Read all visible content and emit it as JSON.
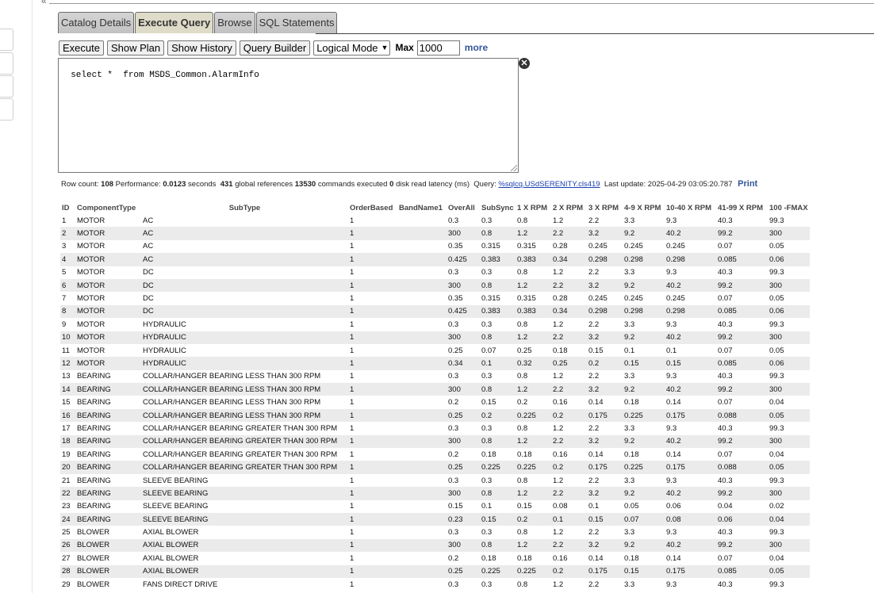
{
  "tabs": [
    {
      "label": "Catalog Details",
      "active": false
    },
    {
      "label": "Execute Query",
      "active": true
    },
    {
      "label": "Browse",
      "active": false
    },
    {
      "label": "SQL Statements",
      "active": false
    }
  ],
  "toolbar": {
    "execute": "Execute",
    "show_plan": "Show Plan",
    "show_history": "Show History",
    "query_builder": "Query Builder",
    "mode": "Logical Mode",
    "max_label": "Max",
    "max_value": "1000",
    "more": "more"
  },
  "query": {
    "text": "select *  from MSDS_Common.AlarmInfo",
    "clear_icon": "close-circle-icon"
  },
  "stats": {
    "row_count_label": "Row count:",
    "row_count": "108",
    "performance_label": "Performance:",
    "performance": "0.0123",
    "seconds": "seconds",
    "global_refs": "431",
    "global_refs_label": "global references",
    "commands": "13530",
    "commands_label": "commands executed",
    "disk_latency": "0",
    "disk_latency_label": "disk read latency (ms)",
    "query_label": "Query:",
    "query_link": "%sqlcq.USdSERENITY.cls419",
    "last_update_label": "Last update:",
    "last_update": "2025-04-29 03:05:20.787",
    "print": "Print"
  },
  "table": {
    "columns": [
      "ID",
      "ComponentType",
      "SubType",
      "OrderBased",
      "BandName1",
      "OverAll",
      "SubSync",
      "1 X RPM",
      "2 X RPM",
      "3 X RPM",
      "4-9 X RPM",
      "10-40 X RPM",
      "41-99 X RPM",
      "100 -FMAX"
    ],
    "rows": [
      [
        "1",
        "MOTOR",
        "AC",
        "1",
        "",
        "0.3",
        "0.3",
        "0.8",
        "1.2",
        "2.2",
        "3.3",
        "9.3",
        "40.3",
        "99.3"
      ],
      [
        "2",
        "MOTOR",
        "AC",
        "1",
        "",
        "300",
        "0.8",
        "1.2",
        "2.2",
        "3.2",
        "9.2",
        "40.2",
        "99.2",
        "300"
      ],
      [
        "3",
        "MOTOR",
        "AC",
        "1",
        "",
        "0.35",
        "0.315",
        "0.315",
        "0.28",
        "0.245",
        "0.245",
        "0.245",
        "0.07",
        "0.05"
      ],
      [
        "4",
        "MOTOR",
        "AC",
        "1",
        "",
        "0.425",
        "0.383",
        "0.383",
        "0.34",
        "0.298",
        "0.298",
        "0.298",
        "0.085",
        "0.06"
      ],
      [
        "5",
        "MOTOR",
        "DC",
        "1",
        "",
        "0.3",
        "0.3",
        "0.8",
        "1.2",
        "2.2",
        "3.3",
        "9.3",
        "40.3",
        "99.3"
      ],
      [
        "6",
        "MOTOR",
        "DC",
        "1",
        "",
        "300",
        "0.8",
        "1.2",
        "2.2",
        "3.2",
        "9.2",
        "40.2",
        "99.2",
        "300"
      ],
      [
        "7",
        "MOTOR",
        "DC",
        "1",
        "",
        "0.35",
        "0.315",
        "0.315",
        "0.28",
        "0.245",
        "0.245",
        "0.245",
        "0.07",
        "0.05"
      ],
      [
        "8",
        "MOTOR",
        "DC",
        "1",
        "",
        "0.425",
        "0.383",
        "0.383",
        "0.34",
        "0.298",
        "0.298",
        "0.298",
        "0.085",
        "0.06"
      ],
      [
        "9",
        "MOTOR",
        "HYDRAULIC",
        "1",
        "",
        "0.3",
        "0.3",
        "0.8",
        "1.2",
        "2.2",
        "3.3",
        "9.3",
        "40.3",
        "99.3"
      ],
      [
        "10",
        "MOTOR",
        "HYDRAULIC",
        "1",
        "",
        "300",
        "0.8",
        "1.2",
        "2.2",
        "3.2",
        "9.2",
        "40.2",
        "99.2",
        "300"
      ],
      [
        "11",
        "MOTOR",
        "HYDRAULIC",
        "1",
        "",
        "0.25",
        "0.07",
        "0.25",
        "0.18",
        "0.15",
        "0.1",
        "0.1",
        "0.07",
        "0.05"
      ],
      [
        "12",
        "MOTOR",
        "HYDRAULIC",
        "1",
        "",
        "0.34",
        "0.1",
        "0.32",
        "0.25",
        "0.2",
        "0.15",
        "0.15",
        "0.085",
        "0.06"
      ],
      [
        "13",
        "BEARING",
        "COLLAR/HANGER BEARING LESS THAN 300 RPM",
        "1",
        "",
        "0.3",
        "0.3",
        "0.8",
        "1.2",
        "2.2",
        "3.3",
        "9.3",
        "40.3",
        "99.3"
      ],
      [
        "14",
        "BEARING",
        "COLLAR/HANGER BEARING LESS THAN 300 RPM",
        "1",
        "",
        "300",
        "0.8",
        "1.2",
        "2.2",
        "3.2",
        "9.2",
        "40.2",
        "99.2",
        "300"
      ],
      [
        "15",
        "BEARING",
        "COLLAR/HANGER BEARING LESS THAN 300 RPM",
        "1",
        "",
        "0.2",
        "0.15",
        "0.2",
        "0.16",
        "0.14",
        "0.18",
        "0.14",
        "0.07",
        "0.04"
      ],
      [
        "16",
        "BEARING",
        "COLLAR/HANGER BEARING LESS THAN 300 RPM",
        "1",
        "",
        "0.25",
        "0.2",
        "0.225",
        "0.2",
        "0.175",
        "0.225",
        "0.175",
        "0.088",
        "0.05"
      ],
      [
        "17",
        "BEARING",
        "COLLAR/HANGER BEARING GREATER THAN 300 RPM",
        "1",
        "",
        "0.3",
        "0.3",
        "0.8",
        "1.2",
        "2.2",
        "3.3",
        "9.3",
        "40.3",
        "99.3"
      ],
      [
        "18",
        "BEARING",
        "COLLAR/HANGER BEARING GREATER THAN 300 RPM",
        "1",
        "",
        "300",
        "0.8",
        "1.2",
        "2.2",
        "3.2",
        "9.2",
        "40.2",
        "99.2",
        "300"
      ],
      [
        "19",
        "BEARING",
        "COLLAR/HANGER BEARING GREATER THAN 300 RPM",
        "1",
        "",
        "0.2",
        "0.18",
        "0.18",
        "0.16",
        "0.14",
        "0.18",
        "0.14",
        "0.07",
        "0.04"
      ],
      [
        "20",
        "BEARING",
        "COLLAR/HANGER BEARING GREATER THAN 300 RPM",
        "1",
        "",
        "0.25",
        "0.225",
        "0.225",
        "0.2",
        "0.175",
        "0.225",
        "0.175",
        "0.088",
        "0.05"
      ],
      [
        "21",
        "BEARING",
        "SLEEVE BEARING",
        "1",
        "",
        "0.3",
        "0.3",
        "0.8",
        "1.2",
        "2.2",
        "3.3",
        "9.3",
        "40.3",
        "99.3"
      ],
      [
        "22",
        "BEARING",
        "SLEEVE BEARING",
        "1",
        "",
        "300",
        "0.8",
        "1.2",
        "2.2",
        "3.2",
        "9.2",
        "40.2",
        "99.2",
        "300"
      ],
      [
        "23",
        "BEARING",
        "SLEEVE BEARING",
        "1",
        "",
        "0.15",
        "0.1",
        "0.15",
        "0.08",
        "0.1",
        "0.05",
        "0.06",
        "0.04",
        "0.02"
      ],
      [
        "24",
        "BEARING",
        "SLEEVE BEARING",
        "1",
        "",
        "0.23",
        "0.15",
        "0.2",
        "0.1",
        "0.15",
        "0.07",
        "0.08",
        "0.06",
        "0.04"
      ],
      [
        "25",
        "BLOWER",
        "AXIAL BLOWER",
        "1",
        "",
        "0.3",
        "0.3",
        "0.8",
        "1.2",
        "2.2",
        "3.3",
        "9.3",
        "40.3",
        "99.3"
      ],
      [
        "26",
        "BLOWER",
        "AXIAL BLOWER",
        "1",
        "",
        "300",
        "0.8",
        "1.2",
        "2.2",
        "3.2",
        "9.2",
        "40.2",
        "99.2",
        "300"
      ],
      [
        "27",
        "BLOWER",
        "AXIAL BLOWER",
        "1",
        "",
        "0.2",
        "0.18",
        "0.18",
        "0.16",
        "0.14",
        "0.18",
        "0.14",
        "0.07",
        "0.04"
      ],
      [
        "28",
        "BLOWER",
        "AXIAL BLOWER",
        "1",
        "",
        "0.25",
        "0.225",
        "0.225",
        "0.2",
        "0.175",
        "0.15",
        "0.175",
        "0.085",
        "0.05"
      ],
      [
        "29",
        "BLOWER",
        "FANS DIRECT DRIVE",
        "1",
        "",
        "0.3",
        "0.3",
        "0.8",
        "1.2",
        "2.2",
        "3.3",
        "9.3",
        "40.3",
        "99.3"
      ]
    ]
  }
}
